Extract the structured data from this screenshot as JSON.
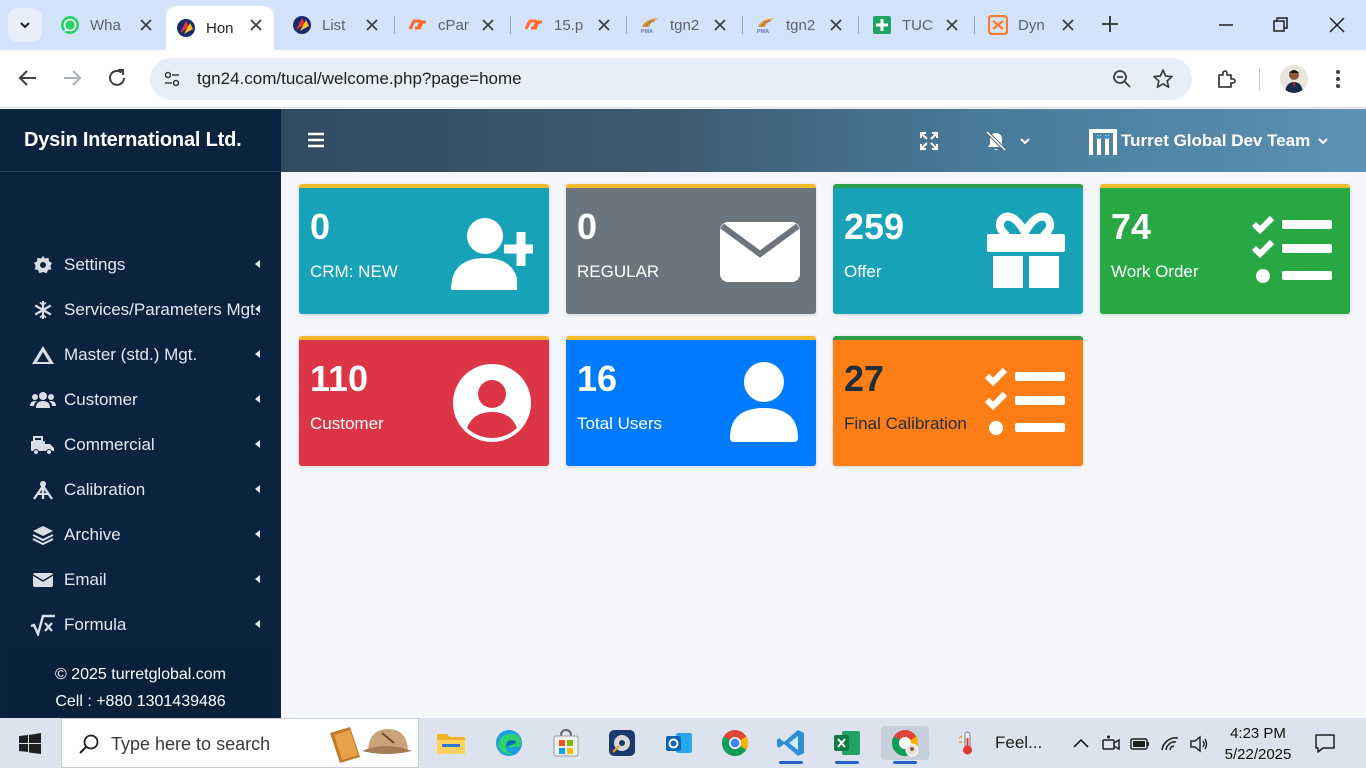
{
  "browser": {
    "tabs": [
      {
        "title": "Wha",
        "icon": "whatsapp-icon",
        "active": false
      },
      {
        "title": "Hon",
        "icon": "site-logo-icon",
        "active": true
      },
      {
        "title": "List",
        "icon": "site-logo-icon",
        "active": false
      },
      {
        "title": "cPar",
        "icon": "cpanel-icon",
        "active": false
      },
      {
        "title": "15.p",
        "icon": "cpanel-icon",
        "active": false
      },
      {
        "title": "tgn2",
        "icon": "phpmyadmin-icon",
        "active": false
      },
      {
        "title": "tgn2",
        "icon": "phpmyadmin-icon",
        "active": false
      },
      {
        "title": "TUC",
        "icon": "sheets-icon",
        "active": false
      },
      {
        "title": "Dyn",
        "icon": "xampp-icon",
        "active": false
      }
    ],
    "url": "tgn24.com/tucal/welcome.php?page=home"
  },
  "sidebar": {
    "brand": "Dysin International Ltd.",
    "items": [
      {
        "label": "Settings",
        "icon": "gear-icon"
      },
      {
        "label": "Services/Parameters Mgt.",
        "icon": "snowflake-icon"
      },
      {
        "label": "Master (std.) Mgt.",
        "icon": "triangle-warning-icon"
      },
      {
        "label": "Customer",
        "icon": "users-icon"
      },
      {
        "label": "Commercial",
        "icon": "truck-icon"
      },
      {
        "label": "Calibration",
        "icon": "tripod-icon"
      },
      {
        "label": "Archive",
        "icon": "layers-icon"
      },
      {
        "label": "Email",
        "icon": "envelope-icon"
      },
      {
        "label": "Formula",
        "icon": "square-root-icon"
      }
    ],
    "footer": {
      "copyright": "© 2025 turretglobal.com",
      "cell": "Cell : +880 1301439486"
    }
  },
  "header": {
    "team_name": "Turret Global Dev Team"
  },
  "cards": [
    {
      "value": "0",
      "label": "CRM: NEW",
      "color": "#17a2b8",
      "icon": "user-plus-icon"
    },
    {
      "value": "0",
      "label": "REGULAR",
      "color": "#6c757d",
      "icon": "envelope-icon"
    },
    {
      "value": "259",
      "label": "Offer",
      "color": "#17a2b8",
      "icon": "gift-icon"
    },
    {
      "value": "74",
      "label": "Work Order",
      "color": "#28a745",
      "icon": "checklist-icon"
    },
    {
      "value": "110",
      "label": "Customer",
      "color": "#dc3545",
      "icon": "user-circle-icon"
    },
    {
      "value": "16",
      "label": "Total Users",
      "color": "#007bff",
      "icon": "user-icon"
    },
    {
      "value": "27",
      "label": "Final Calibration",
      "color": "#fd7e14",
      "icon": "checklist-icon"
    }
  ],
  "taskbar": {
    "search_placeholder": "Type here to search",
    "weather": "Feel...",
    "time": "4:23 PM",
    "date": "5/22/2025"
  }
}
